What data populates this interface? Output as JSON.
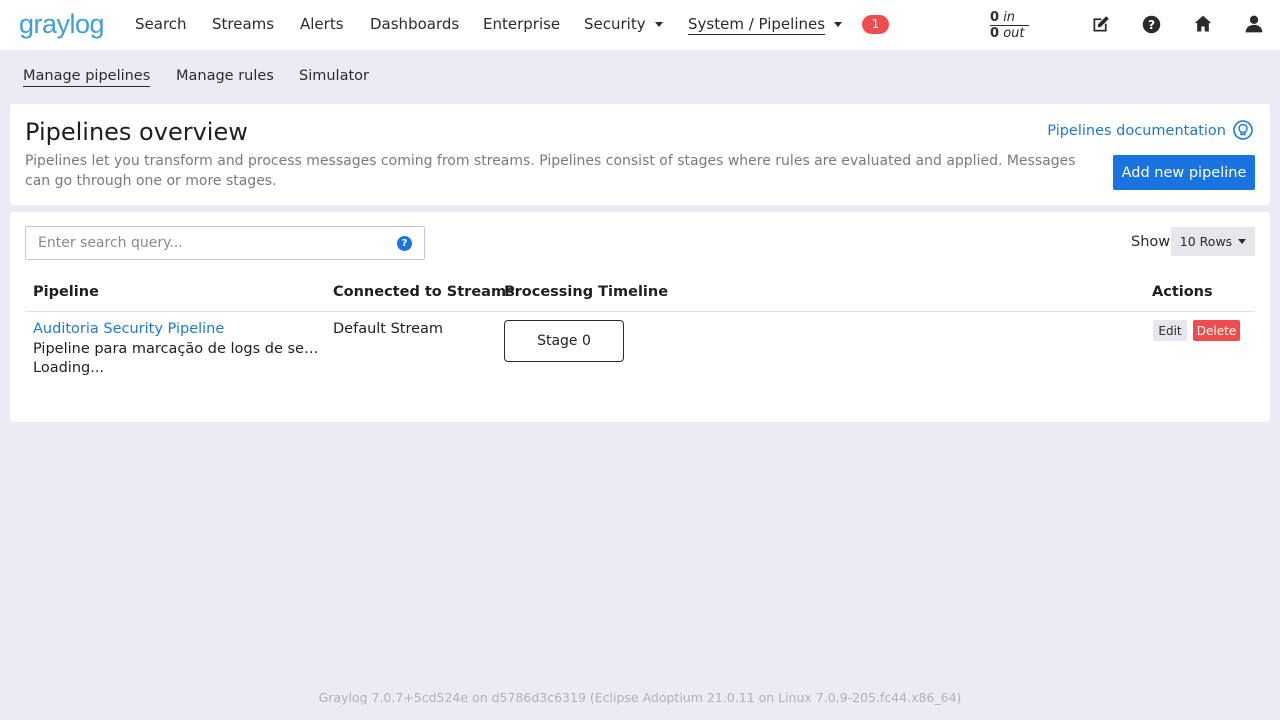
{
  "header": {
    "logo_text": "graylog",
    "nav": [
      {
        "label": "Search"
      },
      {
        "label": "Streams"
      },
      {
        "label": "Alerts"
      },
      {
        "label": "Dashboards"
      },
      {
        "label": "Enterprise"
      },
      {
        "label": "Security"
      },
      {
        "label": "System / Pipelines"
      }
    ],
    "notification_count": "1",
    "throughput": {
      "in_value": "0",
      "in_label": "in",
      "out_value": "0",
      "out_label": "out"
    },
    "icons": [
      "edit-icon",
      "help-icon",
      "home-icon",
      "user-icon"
    ]
  },
  "subnav": {
    "items": [
      {
        "label": "Manage pipelines"
      },
      {
        "label": "Manage rules"
      },
      {
        "label": "Simulator"
      }
    ]
  },
  "overview": {
    "title": "Pipelines overview",
    "description": "Pipelines let you transform and process messages coming from streams. Pipelines consist of stages where rules are evaluated and applied. Messages can go through one or more stages.",
    "doc_link": "Pipelines documentation",
    "add_button": "Add new pipeline"
  },
  "table_controls": {
    "search_placeholder": "Enter search query...",
    "search_help": "?",
    "show_label": "Show",
    "rows_option": "10 Rows"
  },
  "table": {
    "headers": [
      "Pipeline",
      "Connected to Streams",
      "Processing Timeline",
      "Actions"
    ],
    "rows": [
      {
        "name": "Auditoria Security Pipeline",
        "description": "Pipeline para marcação de logs de segurança",
        "status": "Loading...",
        "streams": "Default Stream",
        "stage": "Stage 0",
        "edit": "Edit",
        "delete": "Delete"
      }
    ]
  },
  "footer": {
    "text": "Graylog 7.0.7+5cd524e on d5786d3c6319 (Eclipse Adoptium 21.0.11 on Linux 7.0.9-205.fc44.x86_64)"
  },
  "colors": {
    "accent": "#1a74e0",
    "link": "#1c7ad6",
    "danger": "#ef4d4d",
    "logo": "#3f9fd8",
    "page_bg": "#ecebf5"
  }
}
